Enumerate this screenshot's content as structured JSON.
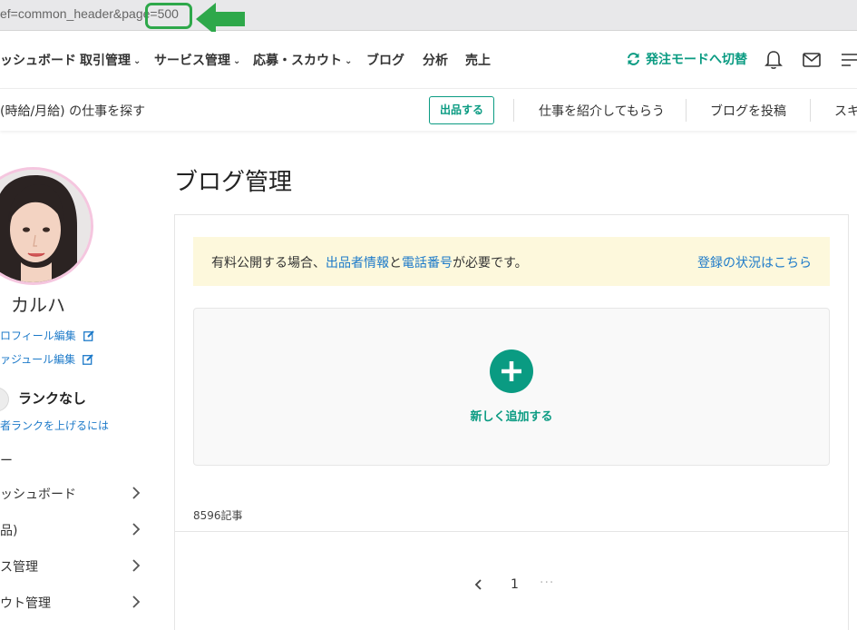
{
  "url": {
    "text": "ef=common_header&page=500"
  },
  "nav": {
    "items": [
      "ッシュボード",
      "取引管理",
      "サービス管理",
      "応募・スカウト",
      "ブログ",
      "分析",
      "売上"
    ],
    "switch_mode": "発注モードへ切替"
  },
  "subnav": {
    "search": "(時給/月給) の仕事を探す",
    "list_button": "出品する",
    "links": [
      "仕事を紹介してもらう",
      "ブログを投稿",
      "スキ"
    ]
  },
  "sidebar": {
    "user_name": "カルハ",
    "profile_edit": "ロフィール編集",
    "schedule_edit": "ァジュール編集",
    "rank": "ランクなし",
    "rank_up": "者ランクを上げるには",
    "dash": "ー",
    "menu": [
      "ッシュボード",
      "品)",
      "ス管理",
      "ウト管理"
    ]
  },
  "main": {
    "title": "ブログ管理",
    "notice": {
      "text_before": "有料公開する場合、",
      "link1": "出品者情報",
      "text_mid": "と",
      "link2": "電話番号",
      "text_after": "が必要です。",
      "status_link": "登録の状況はこちら"
    },
    "add_new": "新しく追加する",
    "count": "8596記事",
    "pagination": {
      "current": "1",
      "ellipsis": "···"
    }
  },
  "colors": {
    "accent": "#0a9b82",
    "link": "#1d7ac9",
    "notice_bg": "#fdf8dc",
    "highlight": "#2ea84a"
  }
}
